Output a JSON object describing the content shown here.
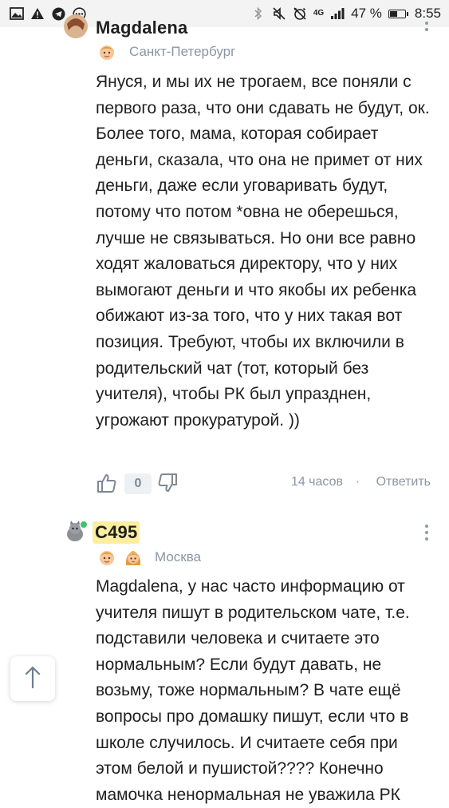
{
  "status_bar": {
    "left_icons": [
      "gallery-icon",
      "warning-icon",
      "telegram-icon",
      "more-circle-icon"
    ],
    "right_icons": [
      "bluetooth-icon",
      "mute-icon",
      "alarm-off-icon"
    ],
    "network": "4G",
    "battery_percent": "47 %",
    "battery_level": 0.47,
    "time": "8:55"
  },
  "comments": [
    {
      "author": "Magdalena",
      "city": "Санкт-Петербург",
      "text": "Януся, и мы их не трогаем, все поняли с первого раза, что они сдавать не будут, ок. Более того, мама, которая собирает деньги, сказала, что она не примет от них деньги, даже если уговаривать будут, потому что потом *овна не оберешься, лучше не связываться. Но они все равно ходят жаловаться директору, что у них вымогают деньги и что якобы их ребенка обижают из-за того, что у них такая вот позиция. Требуют, чтобы их включили в родительский чат (тот, который без учителя), чтобы РК был упразднен, угрожают прокуратурой. ))",
      "votes": "0",
      "time": "14 часов",
      "separator": "·",
      "reply_label": "Ответить"
    },
    {
      "author": "С495",
      "city": "Москва",
      "text": "Magdalena, у нас часто информацию от учителя пишут в родительском чате, т.е. подставили человека и считаете это нормальным? Если будут давать, не возьму, тоже нормальным? В чате ещё вопросы про домашку пишут, если что в школе случилось. И считаете себя при этом белой и пушистой???? Конечно мамочка ненормальная не уважила РК"
    }
  ],
  "colors": {
    "highlight": "#fbef9f",
    "muted": "#8a96a4",
    "online": "#3bc46b"
  }
}
